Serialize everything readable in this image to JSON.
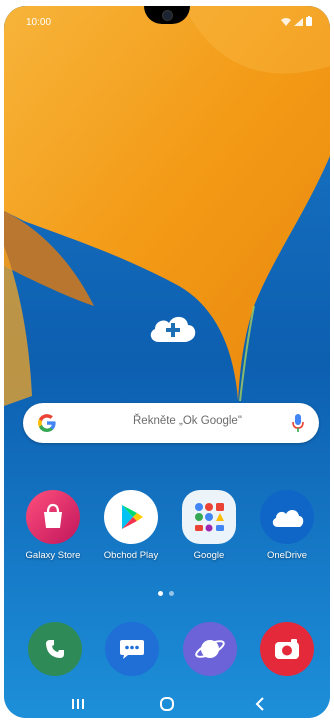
{
  "status_bar": {
    "time": "10:00"
  },
  "search": {
    "hint": "Řekněte „Ok Google\""
  },
  "apps": [
    {
      "label": "Galaxy Store",
      "icon": "galaxy-store-icon"
    },
    {
      "label": "Obchod Play",
      "icon": "play-store-icon"
    },
    {
      "label": "Google",
      "icon": "google-folder-icon"
    },
    {
      "label": "OneDrive",
      "icon": "onedrive-icon"
    }
  ],
  "dock": [
    {
      "icon": "phone-icon"
    },
    {
      "icon": "messages-icon"
    },
    {
      "icon": "internet-icon"
    },
    {
      "icon": "camera-icon"
    }
  ],
  "navigation": [
    "recent-apps-icon",
    "home-icon",
    "back-icon"
  ],
  "colors": {
    "wallpaper_orange": "#f4a51c",
    "wallpaper_blue": "#0d63b3",
    "accent_google_blue": "#4285f4",
    "dock_phone": "#2e8b57",
    "dock_messages": "#1f6fd6",
    "dock_internet": "#6c63d8",
    "dock_camera": "#e4293a"
  },
  "pager": {
    "pages": 2,
    "active": 1
  }
}
